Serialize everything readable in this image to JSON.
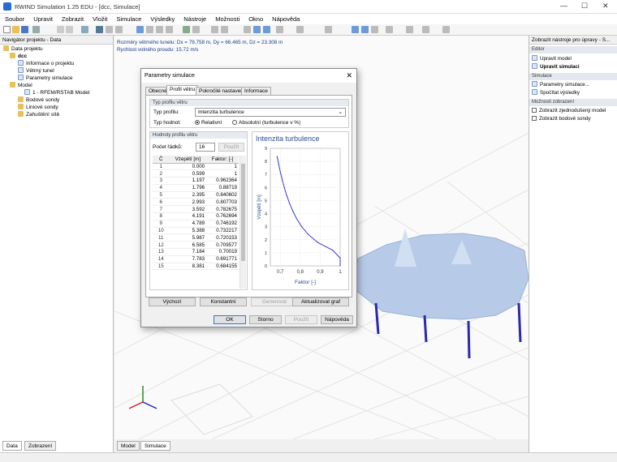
{
  "app": {
    "title": "RWIND Simulation 1.25 EDU - [dcc, Simulace]"
  },
  "menu": [
    "Soubor",
    "Upravit",
    "Zobrazit",
    "Vložit",
    "Simulace",
    "Výsledky",
    "Nástroje",
    "Možnosti",
    "Okno",
    "Nápověda"
  ],
  "left_panel": {
    "title": "Navigátor projektu - Data",
    "tree": {
      "root": "Data projektu",
      "project": "dcc",
      "info": "Informace o projektu",
      "tunnel": "Větrný tunel",
      "sim_params": "Parametry simulace",
      "model": "Model",
      "model_item": "1 - RFEM/RSTAB Model",
      "points": "Bodové sondy",
      "lines": "Liniové sondy",
      "refine": "Zahuštění sítě"
    },
    "tabs": [
      "Data",
      "Zobrazení"
    ]
  },
  "right_panel": {
    "title": "Zobrazit nástroje pro úpravy - S...",
    "sections": {
      "editor": "Editor",
      "simulation": "Simulace",
      "display": "Možnosti zobrazení"
    },
    "items": {
      "edit_model": "Upravit model",
      "edit_sim": "Upravit simulaci",
      "sim_params": "Parametry simulace...",
      "compute": "Spočítat výsledky",
      "simplified": "Zobrazit zjednodušený model",
      "probes": "Zobrazit bodové sondy"
    }
  },
  "viewport": {
    "info1": "Rozměry větrného tunelu: Dx = 79.758 m, Dy = 66.465 m, Dz = 23.308 m",
    "info2": "Rychlost volného proudu: 15.72 m/s",
    "tabs": [
      "Model",
      "Simulace"
    ]
  },
  "dialog": {
    "title": "Parametry simulace",
    "tabs": [
      "Obecné",
      "Profil větru",
      "Pokročilé nastavení",
      "Informace"
    ],
    "active_tab": 1,
    "profile_group": "Typ profilu větru",
    "profile_type_label": "Typ profilu:",
    "profile_type_value": "Intenzita turbulence",
    "type_value_label": "Typ hodnot:",
    "radio_rel": "Relativní",
    "radio_abs": "Absolutní (turbulence v %)",
    "values_group": "Hodnoty profilu větru",
    "rows_label": "Počet řádků:",
    "rows_value": "16",
    "use_btn": "Použít",
    "table": {
      "headers": [
        "Č",
        "Vzepětí [m]",
        "Faktor: [-]"
      ],
      "rows": [
        [
          "1",
          "0.000",
          "1"
        ],
        [
          "2",
          "0.599",
          "1"
        ],
        [
          "3",
          "1.197",
          "0.962364"
        ],
        [
          "4",
          "1.796",
          "0.88719"
        ],
        [
          "5",
          "2.395",
          "0.840602"
        ],
        [
          "6",
          "2.993",
          "0.807703"
        ],
        [
          "7",
          "3.592",
          "0.782675"
        ],
        [
          "8",
          "4.191",
          "0.762694"
        ],
        [
          "9",
          "4.789",
          "0.746192"
        ],
        [
          "10",
          "5.388",
          "0.732217"
        ],
        [
          "11",
          "5.987",
          "0.720153"
        ],
        [
          "12",
          "6.585",
          "0.709577"
        ],
        [
          "13",
          "7.184",
          "0.70019"
        ],
        [
          "14",
          "7.783",
          "0.691771"
        ],
        [
          "15",
          "8.381",
          "0.684155"
        ]
      ]
    },
    "buttons": {
      "wizard": "Výchozí",
      "constant": "Konstantní",
      "generate": "Generovat",
      "update": "Aktualizovat graf",
      "ok": "OK",
      "cancel": "Storno",
      "apply": "Použít",
      "help": "Nápověda"
    }
  },
  "chart_data": {
    "type": "line",
    "title": "Intenzita turbulence",
    "xlabel": "Faktor [-]",
    "ylabel": "Vzepětí [m]",
    "xlim": [
      0.65,
      1.0
    ],
    "ylim": [
      0,
      9
    ],
    "xticks": [
      "0,7",
      "0,8",
      "0,9",
      "1"
    ],
    "yticks": [
      "0",
      "1",
      "2",
      "3",
      "4",
      "5",
      "6",
      "7",
      "8",
      "9"
    ],
    "series": [
      {
        "x": [
          1,
          1,
          0.962364,
          0.88719,
          0.840602,
          0.807703,
          0.782675,
          0.762694,
          0.746192,
          0.732217,
          0.720153,
          0.709577,
          0.70019,
          0.691771,
          0.684155
        ],
        "y": [
          0.0,
          0.599,
          1.197,
          1.796,
          2.395,
          2.993,
          3.592,
          4.191,
          4.789,
          5.388,
          5.987,
          6.585,
          7.184,
          7.783,
          8.381
        ],
        "color": "#3a3ad8"
      }
    ]
  },
  "colors": {
    "accent": "#2d7bd6",
    "series": "#3a3ad8",
    "info_text": "#1a3c8a",
    "tent": "#b7cbe8",
    "columns": "#2a2ab0"
  }
}
